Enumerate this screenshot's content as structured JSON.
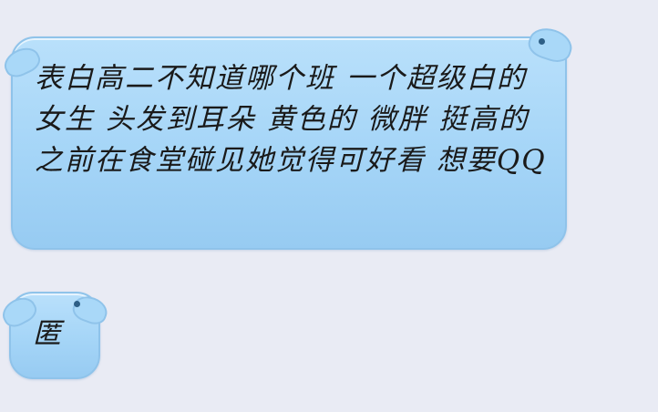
{
  "messages": [
    {
      "text": "表白高二不知道哪个班 一个超级白的女生 头发到耳朵 黄色的 微胖 挺高的 之前在食堂碰见她觉得可好看 想要QQ"
    },
    {
      "text": "匿"
    }
  ],
  "colors": {
    "background": "#e9ebf4",
    "bubble_fill": "#a5d5f7",
    "bubble_border": "#8fc3ea",
    "text": "#1a1a1a"
  }
}
